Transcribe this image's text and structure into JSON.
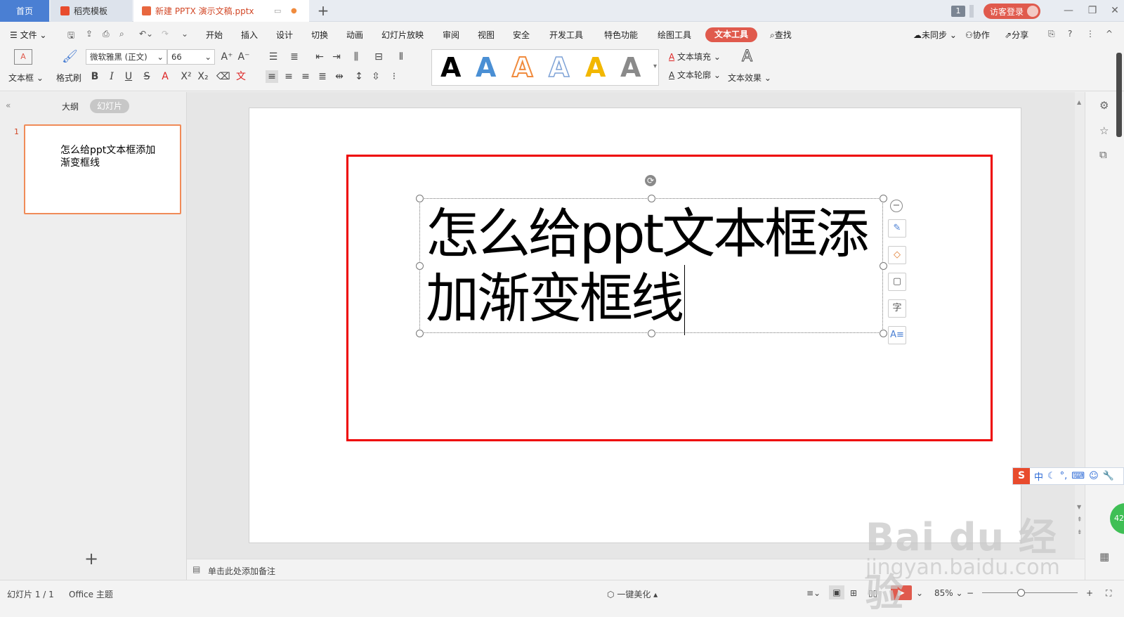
{
  "titlebar": {
    "tab_home": "首页",
    "tab_templates": "稻壳模板",
    "tab_document": "新建 PPTX 演示文稿.pptx",
    "new_tab": "+",
    "window_count": "1",
    "login": "访客登录"
  },
  "menu": {
    "file": "文件",
    "items": [
      "开始",
      "插入",
      "设计",
      "切换",
      "动画",
      "幻灯片放映",
      "审阅",
      "视图",
      "安全",
      "开发工具",
      "特色功能",
      "绘图工具"
    ],
    "active": "文本工具",
    "search": "查找",
    "sync": "未同步",
    "collab": "协作",
    "share": "分享"
  },
  "ribbon": {
    "textbox_label": "文本框",
    "format_painter": "格式刷",
    "font_name": "微软雅黑 (正文)",
    "font_size": "66",
    "text_fill": "文本填充",
    "text_outline": "文本轮廓",
    "text_effects": "文本效果",
    "wordart_colors": [
      "#000000",
      "#4a8fd4",
      "#f08b3e",
      "#7ea2d6",
      "#f2b700",
      "#8a8a8a"
    ]
  },
  "left_panel": {
    "tab_outline": "大纲",
    "tab_slides": "幻灯片",
    "slide_number": "1",
    "thumb_text": "怎么给ppt文本框添加渐变框线"
  },
  "slide": {
    "text_line1": "怎么给ppt文本框添",
    "text_line2": "加渐变框线"
  },
  "notes": {
    "placeholder": "单击此处添加备注"
  },
  "status": {
    "slide_info": "幻灯片 1 / 1",
    "theme": "Office 主题",
    "beautify": "一键美化",
    "zoom": "85%"
  },
  "ime": {
    "lang": "中"
  },
  "watermark": {
    "brand": "Bai du 经验",
    "url": "jingyan.baidu.com"
  },
  "overlay_badge": "42",
  "accent_color": "#e05a4d"
}
